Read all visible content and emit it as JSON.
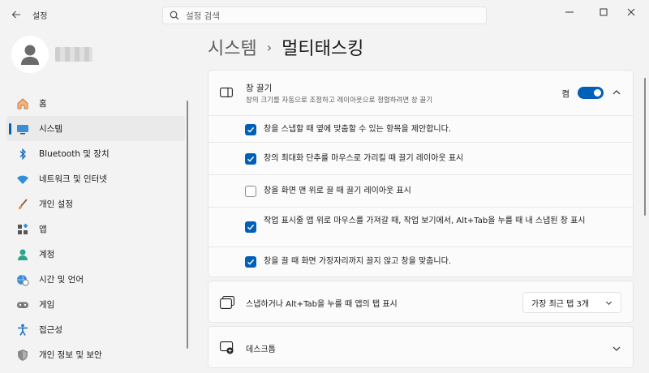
{
  "app": {
    "title": "설정",
    "back_icon": "back-arrow-icon"
  },
  "search": {
    "placeholder": "설정 검색",
    "icon": "search-icon"
  },
  "window_controls": [
    "minimize-icon",
    "maximize-icon",
    "close-icon"
  ],
  "user": {
    "avatar_icon": "user-avatar-icon",
    "name": ""
  },
  "sidebar": {
    "items": [
      {
        "label": "홈",
        "icon": "home-icon",
        "active": false
      },
      {
        "label": "시스템",
        "icon": "system-monitor-icon",
        "active": true
      },
      {
        "label": "Bluetooth 및 장치",
        "icon": "bluetooth-icon",
        "active": false
      },
      {
        "label": "네트워크 및 인터넷",
        "icon": "wifi-icon",
        "active": false
      },
      {
        "label": "개인 설정",
        "icon": "paintbrush-icon",
        "active": false
      },
      {
        "label": "앱",
        "icon": "apps-icon",
        "active": false
      },
      {
        "label": "계정",
        "icon": "account-icon",
        "active": false
      },
      {
        "label": "시간 및 언어",
        "icon": "globe-clock-icon",
        "active": false
      },
      {
        "label": "게임",
        "icon": "gamepad-icon",
        "active": false
      },
      {
        "label": "접근성",
        "icon": "accessibility-icon",
        "active": false
      },
      {
        "label": "개인 정보 및 보안",
        "icon": "shield-icon",
        "active": false
      }
    ]
  },
  "breadcrumb": {
    "parent": "시스템",
    "separator": "›",
    "current": "멀티태스킹"
  },
  "snap": {
    "title": "창 끌기",
    "description": "창의 크기를 자동으로 조정하고 레이아웃으로 정렬하려면 창 끌기",
    "toggle_label": "켬",
    "toggle_on": true,
    "options": [
      {
        "label": "창을 스냅할 때 옆에 맞춤할 수 있는 항목을 제안합니다.",
        "checked": true
      },
      {
        "label": "창의 최대화 단추를 마우스로 가리킬 때 끌기 레이아웃 표시",
        "checked": true
      },
      {
        "label": "창을 화면 맨 위로 끌 때 끌기 레이아웃 표시",
        "checked": false
      },
      {
        "label": "작업 표시줄 앱 위로 마우스를 가져갈 때, 작업 보기에서, Alt+Tab을 누를 때 내 스냅된 창 표시",
        "checked": true
      },
      {
        "label": "창을 끌 때 화면 가장자리까지 끌지 않고 창을 맞춥니다.",
        "checked": true
      }
    ]
  },
  "alt_tab": {
    "label": "스냅하거나 Alt+Tab을 누를 때 앱의 탭 표시",
    "value": "가장 최근 탭 3개"
  },
  "desktops": {
    "label": "데스크톱"
  },
  "colors": {
    "accent": "#005fb8",
    "background": "#f3f3f3",
    "card": "#fbfbfb"
  }
}
